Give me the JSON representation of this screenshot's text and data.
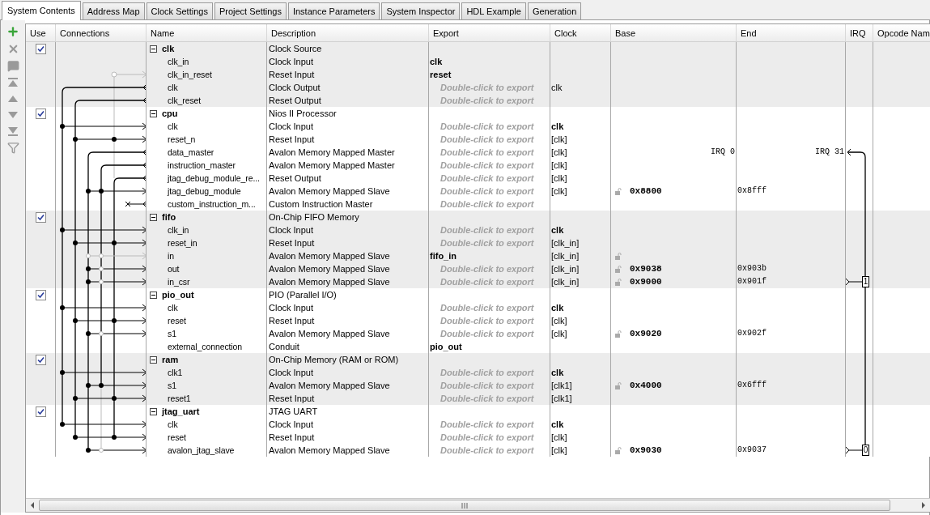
{
  "tabs": [
    {
      "label": "System Contents",
      "selected": true
    },
    {
      "label": "Address Map",
      "selected": false
    },
    {
      "label": "Clock Settings",
      "selected": false
    },
    {
      "label": "Project Settings",
      "selected": false
    },
    {
      "label": "Instance Parameters",
      "selected": false
    },
    {
      "label": "System Inspector",
      "selected": false
    },
    {
      "label": "HDL Example",
      "selected": false
    },
    {
      "label": "Generation",
      "selected": false
    }
  ],
  "columns": [
    "Use",
    "Connections",
    "Name",
    "Description",
    "Export",
    "Clock",
    "Base",
    "End",
    "IRQ",
    "Opcode Nam"
  ],
  "components": [
    {
      "name": "clk",
      "description": "Clock Source",
      "used": true,
      "expanded": true,
      "interfaces": [
        {
          "name": "clk_in",
          "description": "Clock Input",
          "export": "clk"
        },
        {
          "name": "clk_in_reset",
          "description": "Reset Input",
          "export": "reset"
        },
        {
          "name": "clk",
          "description": "Clock Output",
          "export_hint": "Double-click to export",
          "clock": "clk"
        },
        {
          "name": "clk_reset",
          "description": "Reset Output",
          "export_hint": "Double-click to export"
        }
      ]
    },
    {
      "name": "cpu",
      "description": "Nios II Processor",
      "used": true,
      "expanded": true,
      "interfaces": [
        {
          "name": "clk",
          "description": "Clock Input",
          "export_hint": "Double-click to export",
          "clock": "clk",
          "clock_bold": true
        },
        {
          "name": "reset_n",
          "description": "Reset Input",
          "export_hint": "Double-click to export",
          "clock": "[clk]"
        },
        {
          "name": "data_master",
          "description": "Avalon Memory Mapped Master",
          "export_hint": "Double-click to export",
          "clock": "[clk]",
          "irq_from": "IRQ 0",
          "irq_to": "IRQ 31"
        },
        {
          "name": "instruction_master",
          "description": "Avalon Memory Mapped Master",
          "export_hint": "Double-click to export",
          "clock": "[clk]"
        },
        {
          "name": "jtag_debug_module_re...",
          "description": "Reset Output",
          "export_hint": "Double-click to export",
          "clock": "[clk]"
        },
        {
          "name": "jtag_debug_module",
          "description": "Avalon Memory Mapped Slave",
          "export_hint": "Double-click to export",
          "clock": "[clk]",
          "lock": true,
          "base": "0x8800",
          "end": "0x8fff"
        },
        {
          "name": "custom_instruction_m...",
          "description": "Custom Instruction Master",
          "export_hint": "Double-click to export"
        }
      ]
    },
    {
      "name": "fifo",
      "description": "On-Chip FIFO Memory",
      "used": true,
      "expanded": true,
      "interfaces": [
        {
          "name": "clk_in",
          "description": "Clock Input",
          "export_hint": "Double-click to export",
          "clock": "clk",
          "clock_bold": true
        },
        {
          "name": "reset_in",
          "description": "Reset Input",
          "export_hint": "Double-click to export",
          "clock": "[clk_in]"
        },
        {
          "name": "in",
          "description": "Avalon Memory Mapped Slave",
          "export": "fifo_in",
          "clock": "[clk_in]",
          "lock": true
        },
        {
          "name": "out",
          "description": "Avalon Memory Mapped Slave",
          "export_hint": "Double-click to export",
          "clock": "[clk_in]",
          "lock": true,
          "base": "0x9038",
          "end": "0x903b"
        },
        {
          "name": "in_csr",
          "description": "Avalon Memory Mapped Slave",
          "export_hint": "Double-click to export",
          "clock": "[clk_in]",
          "lock": true,
          "base": "0x9000",
          "end": "0x901f",
          "irq": "1"
        }
      ]
    },
    {
      "name": "pio_out",
      "description": "PIO (Parallel I/O)",
      "used": true,
      "expanded": true,
      "interfaces": [
        {
          "name": "clk",
          "description": "Clock Input",
          "export_hint": "Double-click to export",
          "clock": "clk",
          "clock_bold": true
        },
        {
          "name": "reset",
          "description": "Reset Input",
          "export_hint": "Double-click to export",
          "clock": "[clk]"
        },
        {
          "name": "s1",
          "description": "Avalon Memory Mapped Slave",
          "export_hint": "Double-click to export",
          "clock": "[clk]",
          "lock": true,
          "base": "0x9020",
          "end": "0x902f"
        },
        {
          "name": "external_connection",
          "description": "Conduit",
          "export": "pio_out"
        }
      ]
    },
    {
      "name": "ram",
      "description": "On-Chip Memory (RAM or ROM)",
      "used": true,
      "expanded": true,
      "interfaces": [
        {
          "name": "clk1",
          "description": "Clock Input",
          "export_hint": "Double-click to export",
          "clock": "clk",
          "clock_bold": true
        },
        {
          "name": "s1",
          "description": "Avalon Memory Mapped Slave",
          "export_hint": "Double-click to export",
          "clock": "[clk1]",
          "lock": true,
          "base": "0x4000",
          "end": "0x6fff"
        },
        {
          "name": "reset1",
          "description": "Reset Input",
          "export_hint": "Double-click to export",
          "clock": "[clk1]"
        }
      ]
    },
    {
      "name": "jtag_uart",
      "description": "JTAG UART",
      "used": true,
      "expanded": true,
      "interfaces": [
        {
          "name": "clk",
          "description": "Clock Input",
          "export_hint": "Double-click to export",
          "clock": "clk",
          "clock_bold": true
        },
        {
          "name": "reset",
          "description": "Reset Input",
          "export_hint": "Double-click to export",
          "clock": "[clk]"
        },
        {
          "name": "avalon_jtag_slave",
          "description": "Avalon Memory Mapped Slave",
          "export_hint": "Double-click to export",
          "clock": "[clk]",
          "lock": true,
          "base": "0x9030",
          "end": "0x9037",
          "irq": "0"
        }
      ]
    }
  ]
}
